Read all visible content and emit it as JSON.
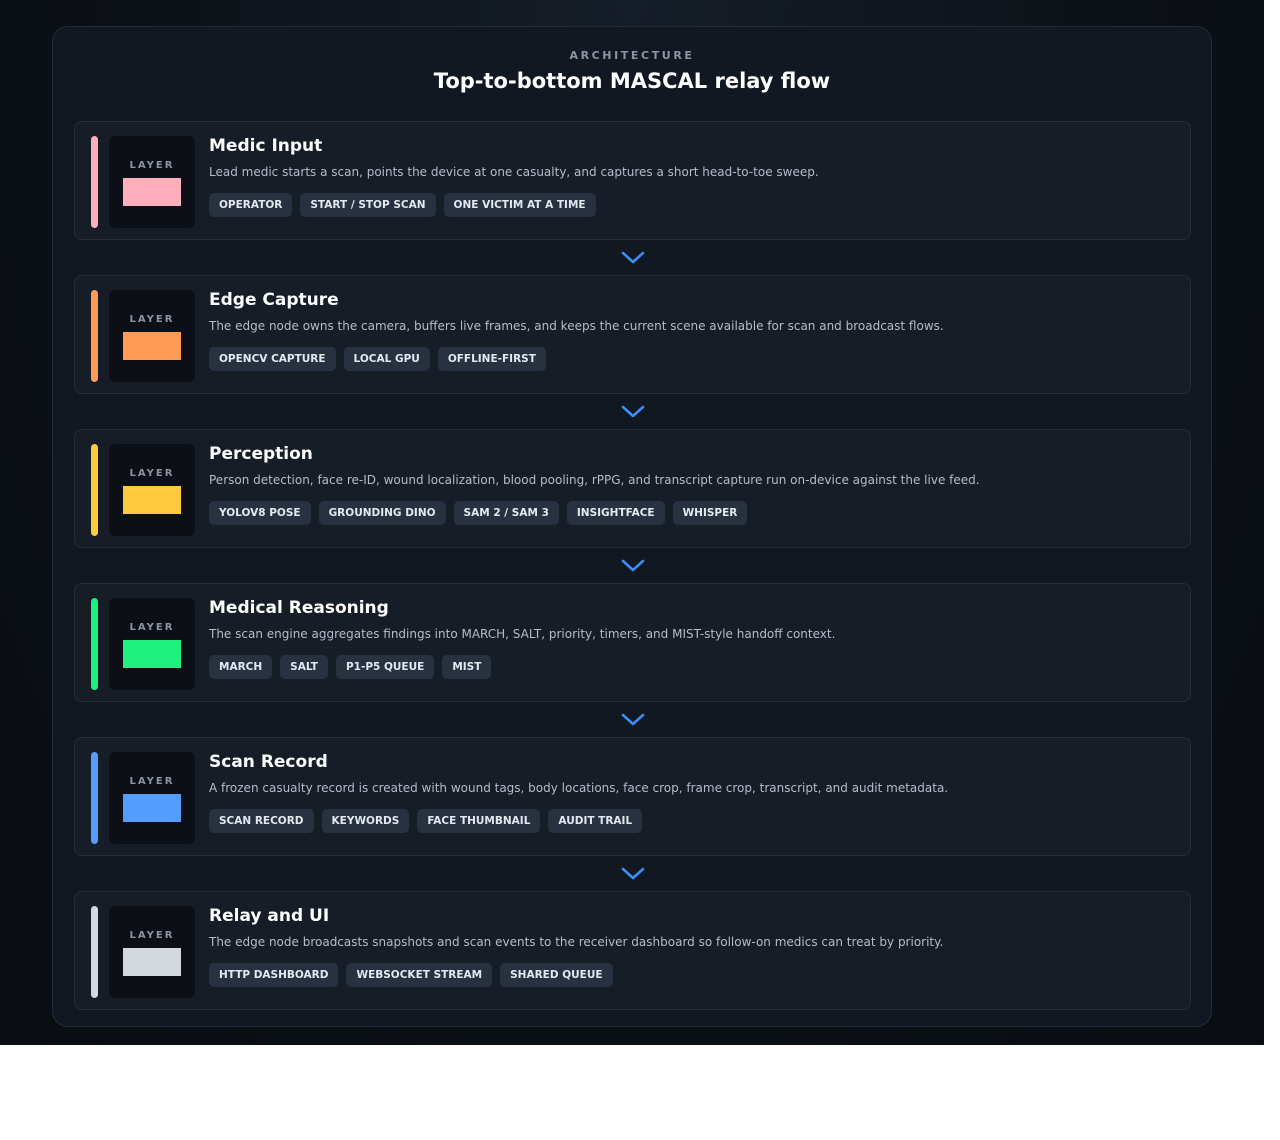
{
  "header": {
    "eyebrow": "ARCHITECTURE",
    "title": "Top-to-bottom MASCAL relay flow"
  },
  "layers": [
    {
      "chip_label": "LAYER",
      "color": "#ffaebe",
      "title": "Medic Input",
      "description": "Lead medic starts a scan, points the device at one casualty, and captures a short head-to-toe sweep.",
      "tags": [
        "OPERATOR",
        "START / STOP SCAN",
        "ONE VICTIM AT A TIME"
      ]
    },
    {
      "chip_label": "LAYER",
      "color": "#ff9b55",
      "title": "Edge Capture",
      "description": "The edge node owns the camera, buffers live frames, and keeps the current scene available for scan and broadcast flows.",
      "tags": [
        "OPENCV CAPTURE",
        "LOCAL GPU",
        "OFFLINE-FIRST"
      ]
    },
    {
      "chip_label": "LAYER",
      "color": "#ffc93d",
      "title": "Perception",
      "description": "Person detection, face re-ID, wound localization, blood pooling, rPPG, and transcript capture run on-device against the live feed.",
      "tags": [
        "YOLOV8 POSE",
        "GROUNDING DINO",
        "SAM 2 / SAM 3",
        "INSIGHTFACE",
        "WHISPER"
      ]
    },
    {
      "chip_label": "LAYER",
      "color": "#1fef7c",
      "title": "Medical Reasoning",
      "description": "The scan engine aggregates findings into MARCH, SALT, priority, timers, and MIST-style handoff context.",
      "tags": [
        "MARCH",
        "SALT",
        "P1-P5 QUEUE",
        "MIST"
      ]
    },
    {
      "chip_label": "LAYER",
      "color": "#539dff",
      "title": "Scan Record",
      "description": "A frozen casualty record is created with wound tags, body locations, face crop, frame crop, transcript, and audit metadata.",
      "tags": [
        "SCAN RECORD",
        "KEYWORDS",
        "FACE THUMBNAIL",
        "AUDIT TRAIL"
      ]
    },
    {
      "chip_label": "LAYER",
      "color": "#d4d8df",
      "title": "Relay and UI",
      "description": "The edge node broadcasts snapshots and scan events to the receiver dashboard so follow-on medics can treat by priority.",
      "tags": [
        "HTTP DASHBOARD",
        "WEBSOCKET STREAM",
        "SHARED QUEUE"
      ]
    }
  ],
  "connector": {
    "icon": "chevron-down-icon",
    "color": "#3b8ef5"
  }
}
